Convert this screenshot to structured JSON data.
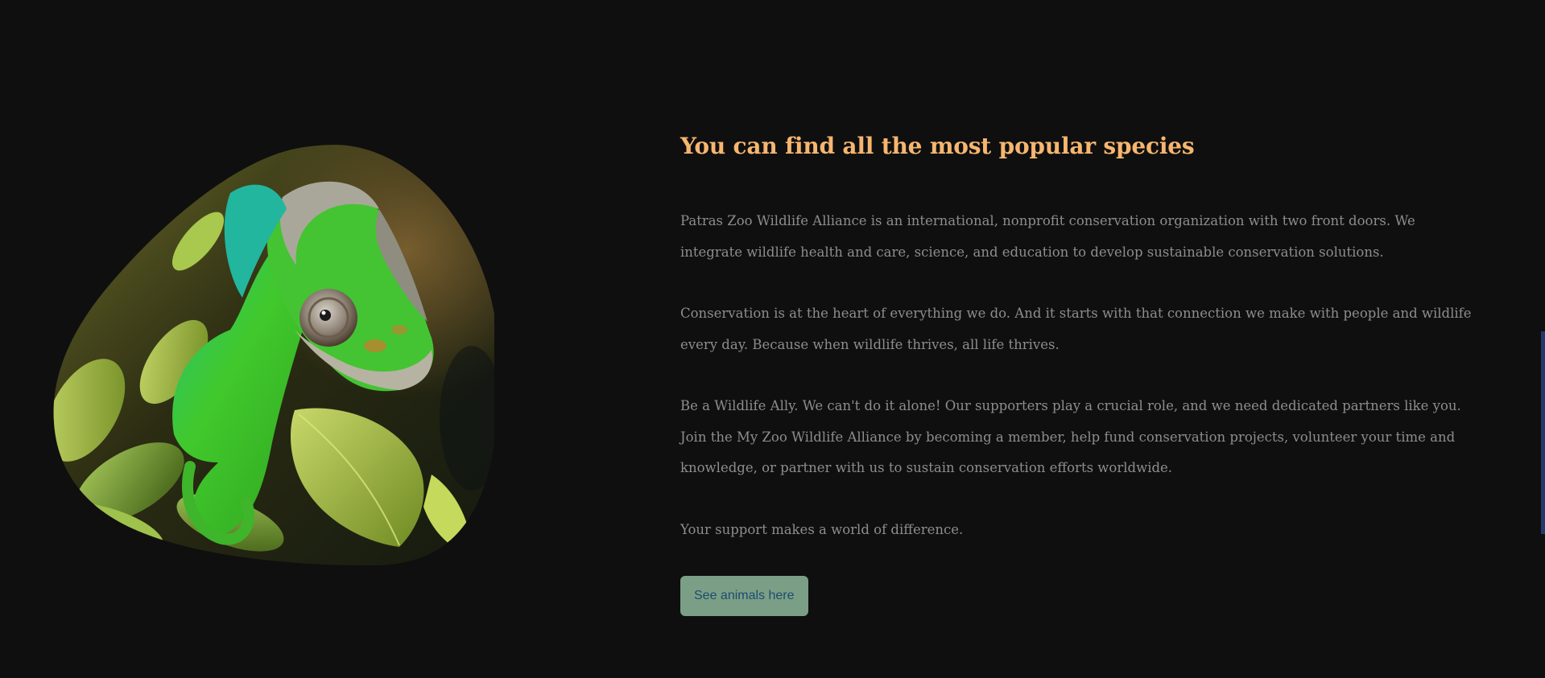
{
  "section": {
    "heading": "You can find all the most popular species",
    "paragraphs": [
      "Patras Zoo Wildlife Alliance is an international, nonprofit conservation organization with two front doors. We integrate wildlife health and care, science, and education to develop sustainable conservation solutions.",
      "Conservation is at the heart of everything we do. And it starts with that connection we make with people and wildlife every day. Because when wildlife thrives, all life thrives.",
      "Be a Wildlife Ally. We can't do it alone! Our supporters play a crucial role, and we need dedicated partners like you. Join the My Zoo Wildlife Alliance by becoming a member, help fund conservation projects, volunteer your time and knowledge, or partner with us to sustain conservation efforts worldwide.",
      "Your support makes a world of difference."
    ],
    "cta_label": "See animals here"
  },
  "image": {
    "subject": "chameleon-photo"
  },
  "colors": {
    "background": "#0f0f0f",
    "heading": "#f6b66f",
    "body_text": "#8d8d8d",
    "button_bg": "#7a9f86",
    "button_text": "#1f4b6e",
    "scroll_thumb": "#223a6b"
  }
}
